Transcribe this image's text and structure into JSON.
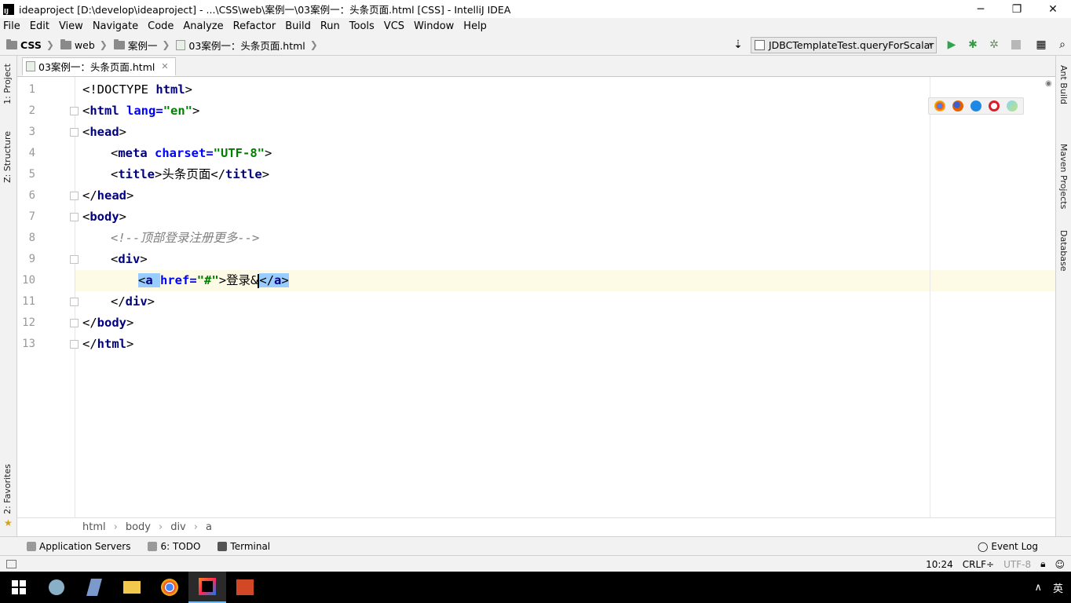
{
  "window": {
    "title": "ideaproject [D:\\develop\\ideaproject] - ...\\CSS\\web\\案例一\\03案例一：头条页面.html [CSS] - IntelliJ IDEA",
    "app_icon_letters": "IJ",
    "controls": {
      "minimize": "─",
      "maximize": "❐",
      "close": "✕"
    }
  },
  "menu": [
    {
      "label": "File"
    },
    {
      "label": "Edit"
    },
    {
      "label": "View"
    },
    {
      "label": "Navigate"
    },
    {
      "label": "Code"
    },
    {
      "label": "Analyze"
    },
    {
      "label": "Refactor"
    },
    {
      "label": "Build"
    },
    {
      "label": "Run"
    },
    {
      "label": "Tools"
    },
    {
      "label": "VCS"
    },
    {
      "label": "Window"
    },
    {
      "label": "Help"
    }
  ],
  "navbar": {
    "crumbs": [
      "CSS",
      "web",
      "案例一",
      "03案例一：头条页面.html"
    ],
    "run_config": "JDBCTemplateTest.queryForScalar"
  },
  "left_tabs": {
    "project": "1: Project",
    "structure": "Z: Structure",
    "favorites": "2: Favorites"
  },
  "right_tabs": {
    "ant": "Ant Build",
    "maven": "Maven Projects",
    "database": "Database"
  },
  "editor": {
    "tab_label": "03案例一：头条页面.html",
    "line_numbers": [
      "1",
      "2",
      "3",
      "4",
      "5",
      "6",
      "7",
      "8",
      "9",
      "10",
      "11",
      "12",
      "13"
    ],
    "lines": {
      "l1_a": "<!DOCTYPE ",
      "l1_b": "html",
      "l1_c": ">",
      "l2_a": "<",
      "l2_b": "html ",
      "l2_c": "lang=",
      "l2_d": "\"en\"",
      "l2_e": ">",
      "l3_a": "<",
      "l3_b": "head",
      "l3_c": ">",
      "l4_a": "<",
      "l4_b": "meta ",
      "l4_c": "charset=",
      "l4_d": "\"UTF-8\"",
      "l4_e": ">",
      "l5_a": "<",
      "l5_b": "title",
      "l5_c": ">",
      "l5_d": "头条页面",
      "l5_e": "</",
      "l5_f": "title",
      "l5_g": ">",
      "l6_a": "</",
      "l6_b": "head",
      "l6_c": ">",
      "l7_a": "<",
      "l7_b": "body",
      "l7_c": ">",
      "l8_a": "<!--顶部登录注册更多-->",
      "l9_a": "<",
      "l9_b": "div",
      "l9_c": ">",
      "l10_a": "<",
      "l10_b": "a ",
      "l10_c": "href=",
      "l10_d": "\"#\"",
      "l10_e": ">",
      "l10_f": "登录&",
      "l10_g": "</",
      "l10_h": "a",
      "l10_i": ">",
      "l11_a": "</",
      "l11_b": "div",
      "l11_c": ">",
      "l12_a": "</",
      "l12_b": "body",
      "l12_c": ">",
      "l13_a": "</",
      "l13_b": "html",
      "l13_c": ">"
    },
    "breadcrumb": [
      "html",
      "body",
      "div",
      "a"
    ]
  },
  "bottom_tools": {
    "app_servers": "Application Servers",
    "todo": "6: TODO",
    "terminal": "Terminal",
    "event_log": "Event Log"
  },
  "status": {
    "position": "10:24",
    "line_sep": "CRLF÷",
    "encoding": "UTF-8"
  },
  "taskbar": {
    "ime": "英"
  },
  "colors": {
    "tag": "#000080",
    "attr": "#0000ff",
    "value": "#008000",
    "comment": "#808080",
    "current_line": "#fdfbe5",
    "selection": "#99ccff"
  }
}
